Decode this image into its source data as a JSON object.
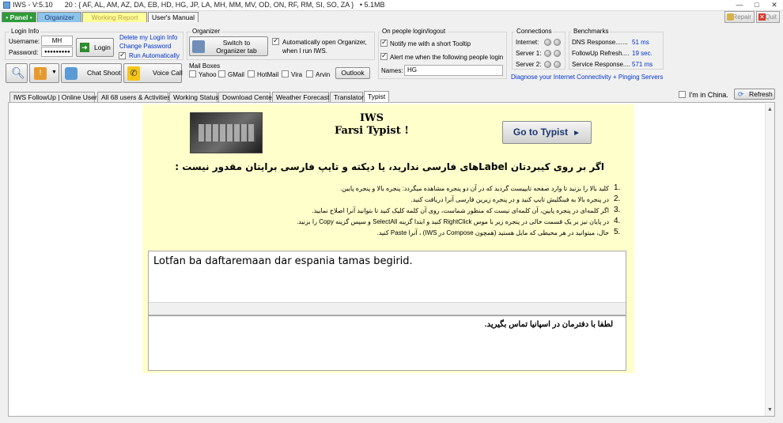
{
  "window": {
    "title": "IWS - V:5.10",
    "sites": "20 : { AF, AL, AM, AZ, DA, EB, HD, HG, JP, LA, MH, MM, MV, OD, ON, RF, RM, SI, SO, ZA }",
    "memory": "5.1MB"
  },
  "top_tabs": [
    "Panel",
    "Organizer",
    "Working Report",
    "User's Manual"
  ],
  "controls": {
    "repair": "Repair",
    "quit": "Quit"
  },
  "login": {
    "group": "Login Info",
    "username_label": "Username:",
    "username": "MH",
    "password_label": "Password:",
    "password": "●●●●●●●●●",
    "login_btn": "Login",
    "delete_link": "Delete my Login Info",
    "change_link": "Change Password",
    "run_auto": "Run Automatically"
  },
  "organizer": {
    "group": "Organizer",
    "switch_btn_line1": "Switch to",
    "switch_btn_line2": "Organizer tab",
    "auto_open_line1": "Automatically open Organizer,",
    "auto_open_line2": "when I run IWS."
  },
  "mailboxes": {
    "group": "Mail Boxes",
    "items": [
      "Yahoo",
      "GMail",
      "HotMail",
      "Vira",
      "Arvin"
    ],
    "outlook_btn": "Outlook"
  },
  "people": {
    "group": "On people login/logout",
    "notify": "Notify me with a short Tooltip",
    "alert": "Alert me when the following people login",
    "names_label": "Names:",
    "names_value": "HG"
  },
  "connections": {
    "group": "Connections",
    "items": [
      "Internet:",
      "Server 1:",
      "Server 2:"
    ]
  },
  "benchmarks": {
    "group": "Benchmarks",
    "items": [
      {
        "label": "DNS Response.......",
        "value": "51 ms"
      },
      {
        "label": "FollowUp Refresh....",
        "value": "19 sec."
      },
      {
        "label": "Service Response....",
        "value": "571 ms"
      }
    ],
    "diagnose": "Diagnose your Internet Connectivity + Pinging Servers"
  },
  "toolbar": {
    "chat": "Chat Shoot",
    "voice": "Voice Call"
  },
  "content_tabs": [
    "IWS FollowUp | Online Users",
    "All 68 users & Activities",
    "Working Status",
    "Download Center",
    "Weather Forecast",
    "Translator",
    "Typist"
  ],
  "china": "I'm in China.",
  "refresh": "Refresh",
  "typist": {
    "title1": "IWS",
    "title2": "Farsi Typist !",
    "go_btn": "Go to Typist",
    "heading": "اگر بر روی کیبردتان Labelهای فارسی ندارید، یا دیکته و تایپ فارسی برایتان مقدور نیست :",
    "steps": [
      "کلید بالا را بزنید تا وارد صفحه تایپیست گردید که در آن دو پنجره مشاهده میگردد: پنجره بالا و پنجره پایین.",
      "در پنجره بالا به فینگلیش تایپ کنید و در پنجره زیرین فارسی آنرا دریافت کنید.",
      "اگر کلمه‌ای در پنجره پایین، آن کلمه‌ای نیست که منظور شماست، روی آن کلمه کلیک کنید تا بتوانید آنرا اصلاح نمایید.",
      "در پایان نیز بر یک قسمت خالی در پنجره زیر با موس RightClick کنید و ابتدا گزینه SelectAll و سپس گزینه Copy را بزنید.",
      "حال، میتوانید در هر محیطی که مایل هستید (همچون Compose در IWS) ، آنرا Paste کنید."
    ],
    "step_numbers": [
      "1.",
      "2.",
      "3.",
      "4.",
      "5."
    ],
    "input_text": "Lotfan ba daftaremaan dar espania tamas begirid.",
    "output_text": "لطفا با دفترمان در اسپانیا تماس بگیرید."
  }
}
